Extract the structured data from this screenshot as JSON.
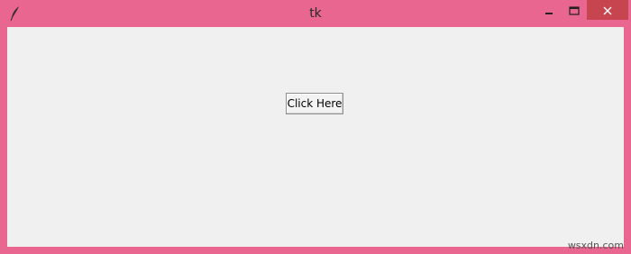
{
  "window": {
    "title": "tk",
    "frame_color": "#e8668f",
    "close_color": "#c7454f",
    "client_color": "#f0f0f0"
  },
  "titlebar": {
    "app_icon": "feather-icon",
    "controls": [
      "minimize-icon",
      "maximize-icon",
      "close-icon"
    ]
  },
  "content": {
    "button_label": "Click Here"
  },
  "watermark": {
    "text": "wsxdn.com"
  }
}
